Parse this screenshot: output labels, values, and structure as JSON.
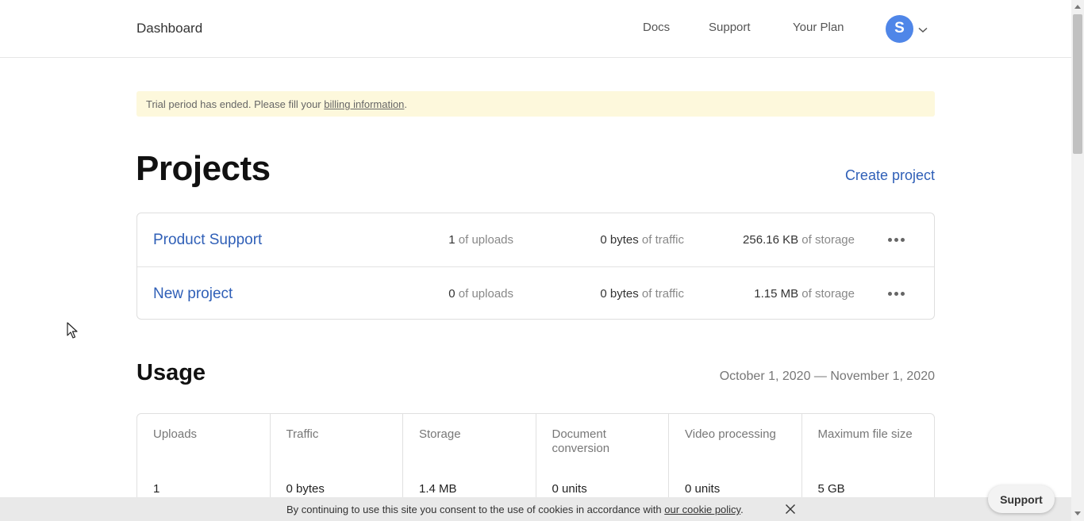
{
  "header": {
    "brand": "Dashboard",
    "nav": {
      "docs": "Docs",
      "support": "Support",
      "plan": "Your Plan"
    },
    "user": {
      "initial": "S",
      "avatar_color": "#4f86e8"
    }
  },
  "banner": {
    "text_before": "Trial period has ended. Please fill your ",
    "link": "billing information",
    "text_after": "."
  },
  "projects": {
    "title": "Projects",
    "create_label": "Create project",
    "items": [
      {
        "name": "Product Support",
        "uploads": "1",
        "uploads_suffix": " of uploads",
        "traffic": "0 bytes",
        "traffic_suffix": " of traffic",
        "storage": "256.16 KB",
        "storage_suffix": " of storage"
      },
      {
        "name": "New project",
        "uploads": "0",
        "uploads_suffix": " of uploads",
        "traffic": "0 bytes",
        "traffic_suffix": " of traffic",
        "storage": "1.15 MB",
        "storage_suffix": " of storage"
      }
    ]
  },
  "usage": {
    "title": "Usage",
    "period": "October 1, 2020 — November 1, 2020",
    "columns": [
      {
        "label": "Uploads",
        "value": "1"
      },
      {
        "label": "Traffic",
        "value": "0 bytes"
      },
      {
        "label": "Storage",
        "value": "1.4 MB"
      },
      {
        "label": "Document conversion",
        "value": "0 units"
      },
      {
        "label": "Video processing",
        "value": "0 units"
      },
      {
        "label": "Maximum file size",
        "value": "5 GB"
      }
    ]
  },
  "cookie": {
    "text": "By continuing to use this site you consent to the use of cookies in accordance with ",
    "link": "our cookie policy",
    "end": "."
  },
  "support_widget": {
    "label": "Support"
  },
  "colors": {
    "link": "#2f5fb7",
    "banner_bg": "#fdf8dc",
    "cookie_bg": "#e9e9e9"
  }
}
